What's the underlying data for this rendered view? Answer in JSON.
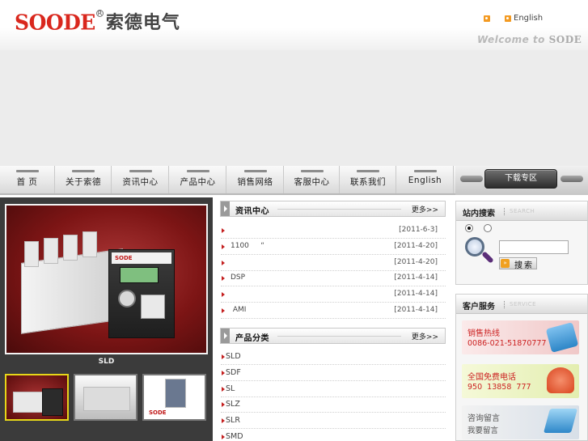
{
  "header": {
    "brand_latin": "SODE",
    "brand_o_accent": "O",
    "brand_cn": "索德电气",
    "rss_label": "",
    "english_label": "English",
    "welcome_text": "Welcome to",
    "welcome_brand": "SODE"
  },
  "nav": {
    "items": [
      {
        "label": "首 页"
      },
      {
        "label": "关于索德"
      },
      {
        "label": "资讯中心"
      },
      {
        "label": "产品中心"
      },
      {
        "label": "销售网络"
      },
      {
        "label": "客服中心"
      },
      {
        "label": "联系我们"
      },
      {
        "label": "English"
      }
    ],
    "download_label": "下载专区"
  },
  "product_showcase": {
    "caption": "SLD",
    "device_label": "SODE"
  },
  "news": {
    "title": "资讯中心",
    "more": "更多>>",
    "items": [
      {
        "title": "",
        "date": "[2011-6-3]"
      },
      {
        "title": "1100     “",
        "date": "[2011-4-20]"
      },
      {
        "title": "",
        "date": "[2011-4-20]"
      },
      {
        "title": "DSP",
        "date": "[2011-4-14]"
      },
      {
        "title": "",
        "date": "[2011-4-14]"
      },
      {
        "title": " AMI",
        "date": "[2011-4-14]"
      }
    ]
  },
  "categories": {
    "title": "产品分类",
    "more": "更多>>",
    "items": [
      {
        "name": "SLD"
      },
      {
        "name": "SDF"
      },
      {
        "name": "SL"
      },
      {
        "name": "SLZ"
      },
      {
        "name": "SLR"
      },
      {
        "name": "SMD"
      }
    ]
  },
  "search": {
    "title": "站内搜索",
    "subtitle": "SEARCH",
    "button_label": "搜索",
    "input_value": ""
  },
  "service": {
    "title": "客户服务",
    "subtitle": "SERVICE",
    "cards": [
      {
        "title": "销售热线",
        "phone": "0086-021-51870777"
      },
      {
        "title": "全国免费电话",
        "phone": "950  13858  777"
      },
      {
        "title": "咨询留言",
        "phone": "我要留言"
      }
    ]
  },
  "colors": {
    "brand_red": "#d9271d",
    "bullet_red": "#c41f1f",
    "thumb_active": "#e6d619"
  }
}
